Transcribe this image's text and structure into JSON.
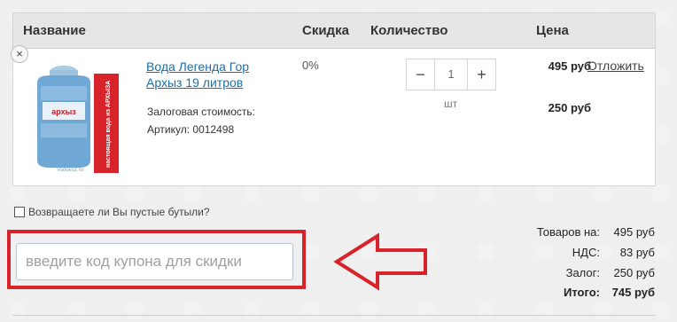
{
  "header": {
    "name": "Название",
    "discount": "Скидка",
    "quantity": "Количество",
    "price": "Цена"
  },
  "item": {
    "remove": "×",
    "name": "Вода Легенда Гор Архыз 19 литров",
    "deposit_label": "Залоговая стоимость:",
    "article_label": "Артикул: 0012498",
    "discount": "0%",
    "qty_minus": "−",
    "qty": "1",
    "qty_plus": "+",
    "unit": "шт",
    "price": "495 руб",
    "deposit_price": "250 руб",
    "postpone": "Отложить",
    "image": {
      "brand": "архыз",
      "slogan": "настоящая вода из АРХЫЗА",
      "site": "Vodovoz.ru"
    }
  },
  "bottles_label": "Возвращаете ли Вы пустые бутыли?",
  "coupon": {
    "placeholder": "введите код купона для скидки"
  },
  "summary": {
    "goods_label": "Товаров на:",
    "goods_value": "495 руб",
    "vat_label": "НДС:",
    "vat_value": "83 руб",
    "deposit_label": "Залог:",
    "deposit_value": "250 руб",
    "total_label": "Итого:",
    "total_value": "745 руб"
  },
  "colors": {
    "highlight": "#d8232a",
    "link": "#1a6fa8"
  }
}
